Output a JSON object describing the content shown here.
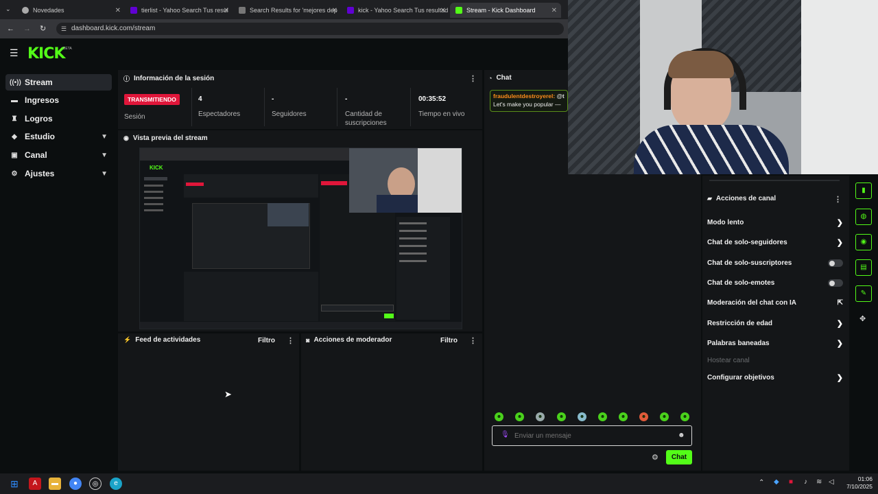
{
  "browser": {
    "tabs": [
      {
        "title": "Novedades",
        "active": false
      },
      {
        "title": "tierlist - Yahoo Search Tus resul",
        "active": false
      },
      {
        "title": "Search Results for 'mejores dep",
        "active": false
      },
      {
        "title": "kick - Yahoo Search Tus resultad",
        "active": false
      },
      {
        "title": "Stream - Kick Dashboard",
        "active": true
      }
    ],
    "url": "dashboard.kick.com/stream"
  },
  "app": {
    "logo": "KICK",
    "logo_badge": "BETA"
  },
  "sidebar": {
    "items": [
      {
        "label": "Stream",
        "icon": "broadcast-icon"
      },
      {
        "label": "Ingresos",
        "icon": "money-icon"
      },
      {
        "label": "Logros",
        "icon": "trophy-icon"
      },
      {
        "label": "Estudio",
        "icon": "studio-icon"
      },
      {
        "label": "Canal",
        "icon": "channel-icon"
      },
      {
        "label": "Ajustes",
        "icon": "gear-icon"
      }
    ]
  },
  "session": {
    "title": "Información de la sesión",
    "status_badge": "TRANSMITIENDO",
    "status_label": "Sesión",
    "stats": [
      {
        "value": "4",
        "label": "Espectadores"
      },
      {
        "value": "-",
        "label": "Seguidores"
      },
      {
        "value": "-",
        "label": "Cantidad de suscripciones"
      },
      {
        "value": "00:35:52",
        "label": "Tiempo en vivo"
      }
    ]
  },
  "preview": {
    "title": "Vista previa del stream"
  },
  "activity_feed": {
    "title": "Feed de actividades",
    "filter": "Filtro"
  },
  "mod_actions": {
    "title": "Acciones de moderador",
    "filter": "Filtro"
  },
  "chat": {
    "title": "Chat",
    "message_user": "fraudulentdestroyerel:",
    "message_mention": "@t",
    "message_text": "Let's make you popular —",
    "input_placeholder": "Enviar un mensaje",
    "send_label": "Chat"
  },
  "channel_actions": {
    "title": "Acciones de canal",
    "items": [
      {
        "label": "Modo lento",
        "control": "chevron"
      },
      {
        "label": "Chat de solo-seguidores",
        "control": "chevron"
      },
      {
        "label": "Chat de solo-suscriptores",
        "control": "toggle"
      },
      {
        "label": "Chat de solo-emotes",
        "control": "toggle"
      },
      {
        "label": "Moderación del chat con IA",
        "control": "external"
      },
      {
        "label": "Restricción de edad",
        "control": "chevron"
      },
      {
        "label": "Palabras baneadas",
        "control": "chevron"
      },
      {
        "label": "Hostear canal",
        "control": "disabled"
      },
      {
        "label": "Configurar objetivos",
        "control": "chevron"
      }
    ]
  },
  "taskbar": {
    "time": "01:06",
    "date": "7/10/2025"
  },
  "colors": {
    "accent": "#53fc18",
    "live": "#e0163a",
    "bg": "#0b0e0f",
    "panel": "#141618"
  }
}
